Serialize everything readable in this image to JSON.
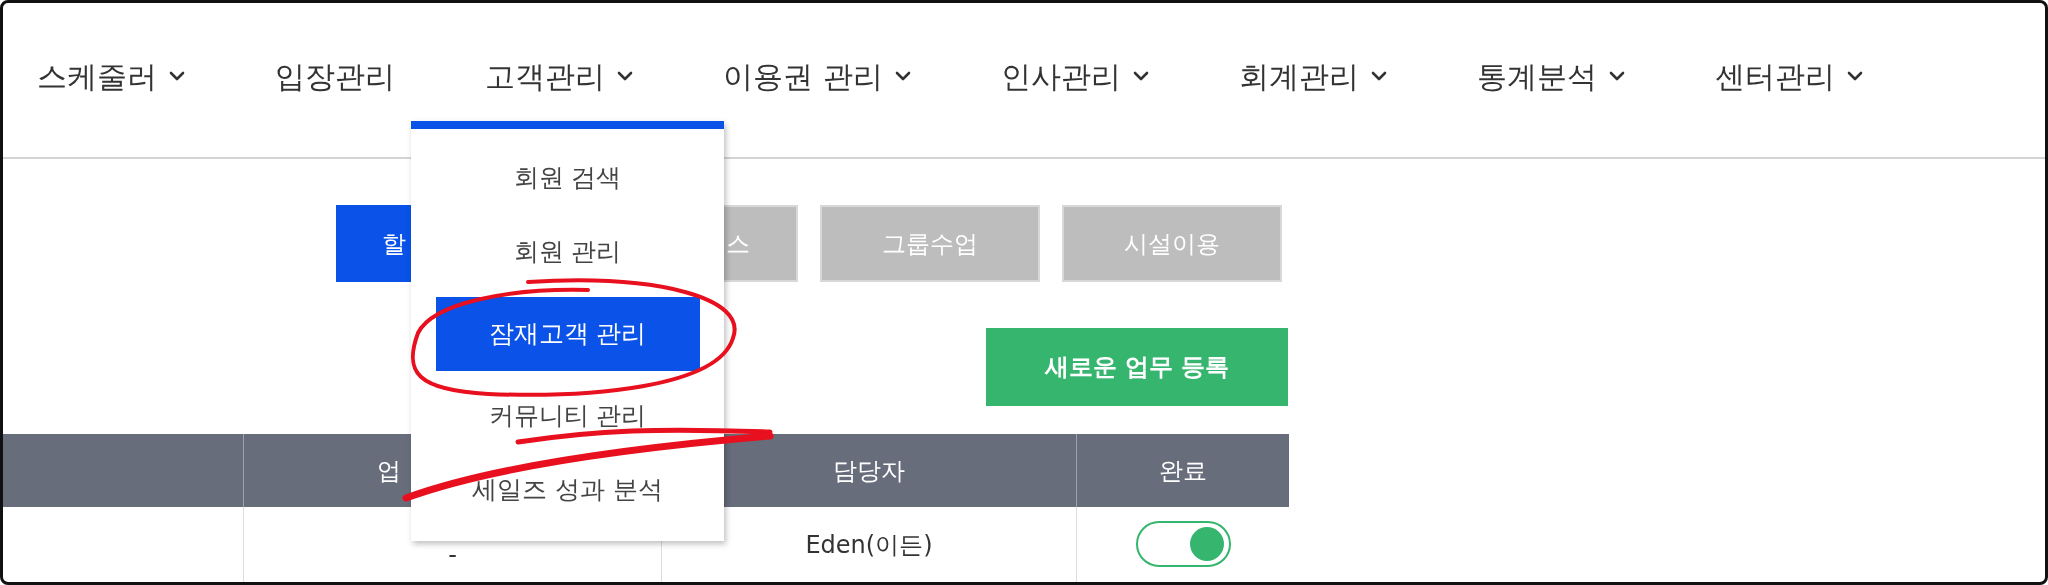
{
  "nav": [
    {
      "label": "스케줄러",
      "has_menu": true
    },
    {
      "label": "입장관리",
      "has_menu": false
    },
    {
      "label": "고객관리",
      "has_menu": true
    },
    {
      "label": "이용권 관리",
      "has_menu": true
    },
    {
      "label": "인사관리",
      "has_menu": true
    },
    {
      "label": "회계관리",
      "has_menu": true
    },
    {
      "label": "통계분석",
      "has_menu": true
    },
    {
      "label": "센터관리",
      "has_menu": true
    }
  ],
  "dropdown": [
    {
      "label": "회원 검색",
      "selected": false
    },
    {
      "label": "회원 관리",
      "selected": false
    },
    {
      "label": "잠재고객 관리",
      "selected": true
    },
    {
      "label": "커뮤니티 관리",
      "selected": false
    },
    {
      "label": "세일즈 성과 분석",
      "selected": false
    }
  ],
  "tabs": [
    {
      "label": "할",
      "selected": true
    },
    {
      "label": "스",
      "selected": false
    },
    {
      "label": "그룹수업",
      "selected": false
    },
    {
      "label": "시설이용",
      "selected": false
    }
  ],
  "new_task_button": "새로운 업무 등록",
  "table": {
    "columns": [
      "업",
      "담당자",
      "완료"
    ],
    "rows": [
      {
        "cell_2": "-",
        "cell_3": "Eden(이든)",
        "done": true
      }
    ]
  }
}
